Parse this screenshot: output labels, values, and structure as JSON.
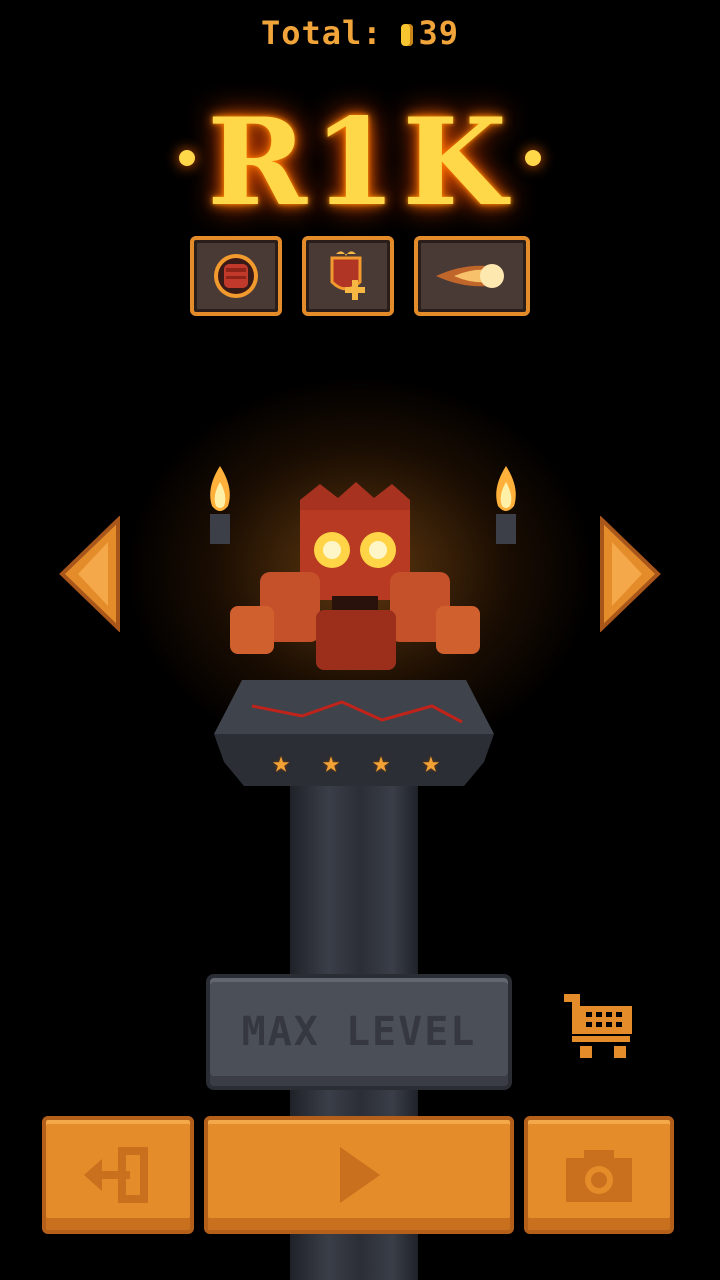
{
  "header": {
    "total_label": "Total:",
    "coins": "39"
  },
  "character": {
    "name": "R1K",
    "stars": 4
  },
  "skills": [
    {
      "icon": "fist-icon"
    },
    {
      "icon": "shield-plus-icon"
    },
    {
      "icon": "fireball-icon"
    }
  ],
  "upgrade": {
    "label": "MAX LEVEL"
  },
  "colors": {
    "accent": "#e48b2a",
    "title_glow": "#ff6a00",
    "disabled": "#4b4f58"
  },
  "controls": {
    "prev_icon": "arrow-left-icon",
    "next_icon": "arrow-right-icon",
    "shop_icon": "cart-icon",
    "exit_icon": "exit-icon",
    "play_icon": "play-icon",
    "camera_icon": "camera-icon"
  }
}
